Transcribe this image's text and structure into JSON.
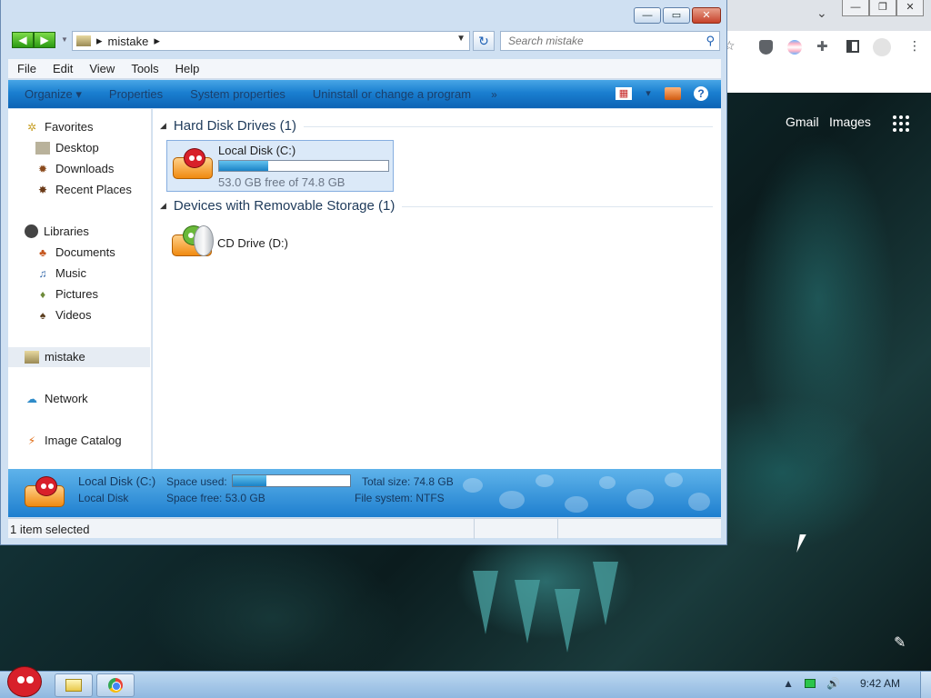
{
  "browser": {
    "caption": {
      "minimize": "—",
      "restore": "❐",
      "close": "✕"
    },
    "dropdown": "⌄",
    "toolbar_icons": [
      "star-icon",
      "ublock-icon",
      "extension-icon",
      "puzzle-icon",
      "sidebar-icon",
      "profile-icon",
      "menu-icon"
    ],
    "links": {
      "gmail": "Gmail",
      "images": "Images"
    }
  },
  "explorer": {
    "caption": {
      "minimize": "—",
      "maximize": "▭",
      "close": "✕"
    },
    "nav": {
      "back": "◀",
      "forward": "▶"
    },
    "address": {
      "crumb": "mistake",
      "sep": "▸"
    },
    "search": {
      "placeholder": "Search mistake"
    },
    "menu": [
      "File",
      "Edit",
      "View",
      "Tools",
      "Help"
    ],
    "commands": [
      "Organize",
      "Properties",
      "System properties",
      "Uninstall or change a program"
    ],
    "organize_arrow": "▾",
    "more": "»",
    "help": "?",
    "sidebar": {
      "favorites": "Favorites",
      "favorites_items": [
        "Desktop",
        "Downloads",
        "Recent Places"
      ],
      "libraries": "Libraries",
      "libraries_items": [
        "Documents",
        "Music",
        "Pictures",
        "Videos"
      ],
      "computer": "mistake",
      "network": "Network",
      "catalog": "Image Catalog"
    },
    "groups": [
      {
        "title": "Hard Disk Drives (1)"
      },
      {
        "title": "Devices with Removable Storage (1)"
      }
    ],
    "local_disk": {
      "name": "Local Disk (C:)",
      "free_text": "53.0 GB free of 74.8 GB",
      "used_fraction": 0.29
    },
    "cd_drive": {
      "name": "CD Drive (D:)"
    },
    "details": {
      "name": "Local Disk (C:)",
      "type": "Local Disk",
      "space_used_label": "Space used:",
      "space_free": "Space free: 53.0 GB",
      "total_size": "Total size: 74.8 GB",
      "file_system": "File system: NTFS"
    },
    "status": {
      "text": "1 item selected"
    }
  },
  "taskbar": {
    "clock": "9:42 AM",
    "tray_arrow": "▲",
    "volume": "🔊"
  },
  "colors": {
    "accent_blue": "#1a7fd0",
    "progress_fill": "#1a82c6",
    "close_red": "#c6422a"
  }
}
